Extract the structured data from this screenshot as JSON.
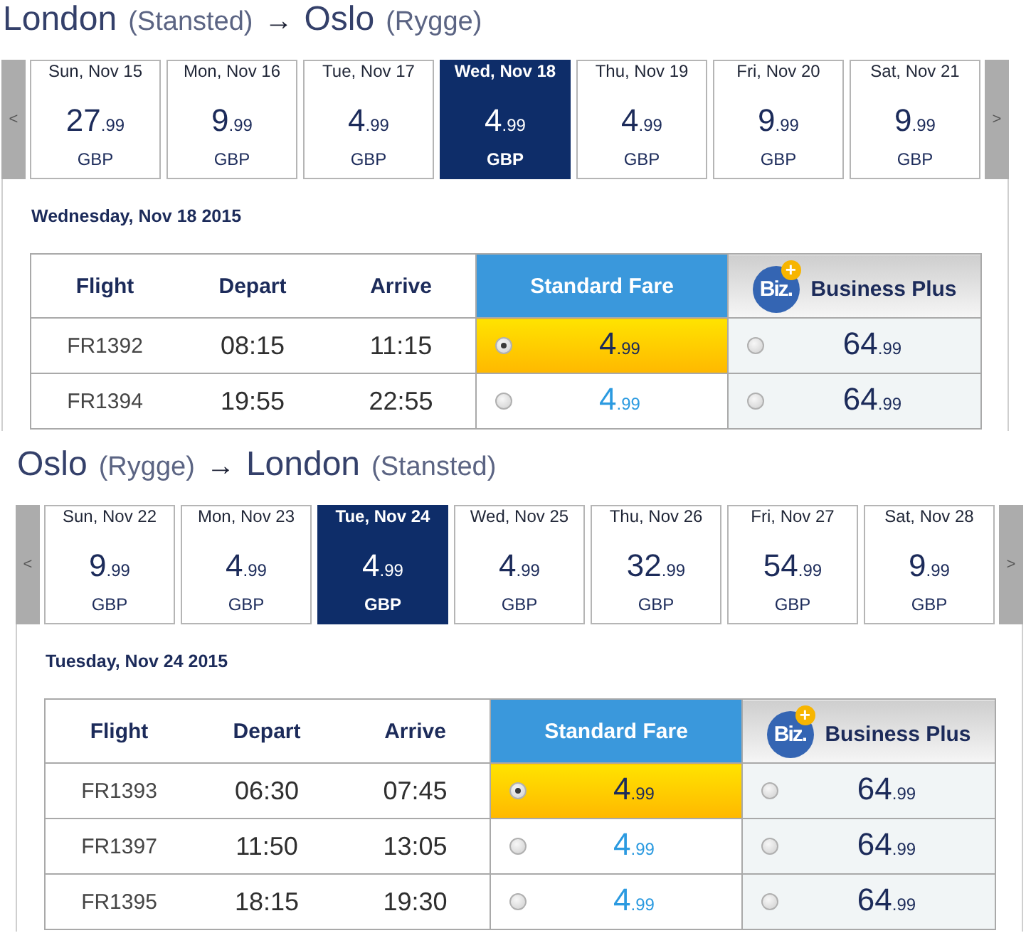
{
  "routes": [
    {
      "origin": "London",
      "origin_airport": "(Stansted)",
      "arrow": "→",
      "destination": "Oslo",
      "destination_airport": "(Rygge)",
      "prev": "<",
      "next": ">",
      "dates": [
        {
          "day": "Sun, Nov 15",
          "price": "27.99",
          "currency": "GBP",
          "selected": false
        },
        {
          "day": "Mon, Nov 16",
          "price": "9.99",
          "currency": "GBP",
          "selected": false
        },
        {
          "day": "Tue, Nov 17",
          "price": "4.99",
          "currency": "GBP",
          "selected": false
        },
        {
          "day": "Wed, Nov 18",
          "price": "4.99",
          "currency": "GBP",
          "selected": true
        },
        {
          "day": "Thu, Nov 19",
          "price": "4.99",
          "currency": "GBP",
          "selected": false
        },
        {
          "day": "Fri, Nov 20",
          "price": "9.99",
          "currency": "GBP",
          "selected": false
        },
        {
          "day": "Sat, Nov 21",
          "price": "9.99",
          "currency": "GBP",
          "selected": false
        }
      ],
      "date_heading": "Wednesday, Nov 18 2015",
      "columns": [
        {
          "label": "Flight",
          "kind": "info"
        },
        {
          "label": "Depart",
          "kind": "info"
        },
        {
          "label": "Arrive",
          "kind": "info"
        },
        {
          "label": "Standard Fare",
          "kind": "standard"
        },
        {
          "label": "Business Plus",
          "kind": "business",
          "logo": "Biz.",
          "logo_badge": "+"
        }
      ],
      "flights": [
        {
          "flight": "FR1392",
          "depart": "08:15",
          "arrive": "11:15",
          "fares": [
            {
              "price": "4.99",
              "selected": true
            },
            {
              "price": "64.99",
              "selected": false
            }
          ]
        },
        {
          "flight": "FR1394",
          "depart": "19:55",
          "arrive": "22:55",
          "fares": [
            {
              "price": "4.99",
              "selected": false
            },
            {
              "price": "64.99",
              "selected": false
            }
          ]
        }
      ]
    },
    {
      "origin": "Oslo",
      "origin_airport": "(Rygge)",
      "arrow": "→",
      "destination": "London",
      "destination_airport": "(Stansted)",
      "prev": "<",
      "next": ">",
      "dates": [
        {
          "day": "Sun, Nov 22",
          "price": "9.99",
          "currency": "GBP",
          "selected": false
        },
        {
          "day": "Mon, Nov 23",
          "price": "4.99",
          "currency": "GBP",
          "selected": false
        },
        {
          "day": "Tue, Nov 24",
          "price": "4.99",
          "currency": "GBP",
          "selected": true
        },
        {
          "day": "Wed, Nov 25",
          "price": "4.99",
          "currency": "GBP",
          "selected": false
        },
        {
          "day": "Thu, Nov 26",
          "price": "32.99",
          "currency": "GBP",
          "selected": false
        },
        {
          "day": "Fri, Nov 27",
          "price": "54.99",
          "currency": "GBP",
          "selected": false
        },
        {
          "day": "Sat, Nov 28",
          "price": "9.99",
          "currency": "GBP",
          "selected": false
        }
      ],
      "date_heading": "Tuesday, Nov 24 2015",
      "columns": [
        {
          "label": "Flight",
          "kind": "info"
        },
        {
          "label": "Depart",
          "kind": "info"
        },
        {
          "label": "Arrive",
          "kind": "info"
        },
        {
          "label": "Standard Fare",
          "kind": "standard"
        },
        {
          "label": "Business Plus",
          "kind": "business",
          "logo": "Biz.",
          "logo_badge": "+"
        }
      ],
      "flights": [
        {
          "flight": "FR1393",
          "depart": "06:30",
          "arrive": "07:45",
          "fares": [
            {
              "price": "4.99",
              "selected": true
            },
            {
              "price": "64.99",
              "selected": false
            }
          ]
        },
        {
          "flight": "FR1397",
          "depart": "11:50",
          "arrive": "13:05",
          "fares": [
            {
              "price": "4.99",
              "selected": false
            },
            {
              "price": "64.99",
              "selected": false
            }
          ]
        },
        {
          "flight": "FR1395",
          "depart": "18:15",
          "arrive": "19:30",
          "fares": [
            {
              "price": "4.99",
              "selected": false
            },
            {
              "price": "64.99",
              "selected": false
            }
          ]
        }
      ]
    }
  ]
}
